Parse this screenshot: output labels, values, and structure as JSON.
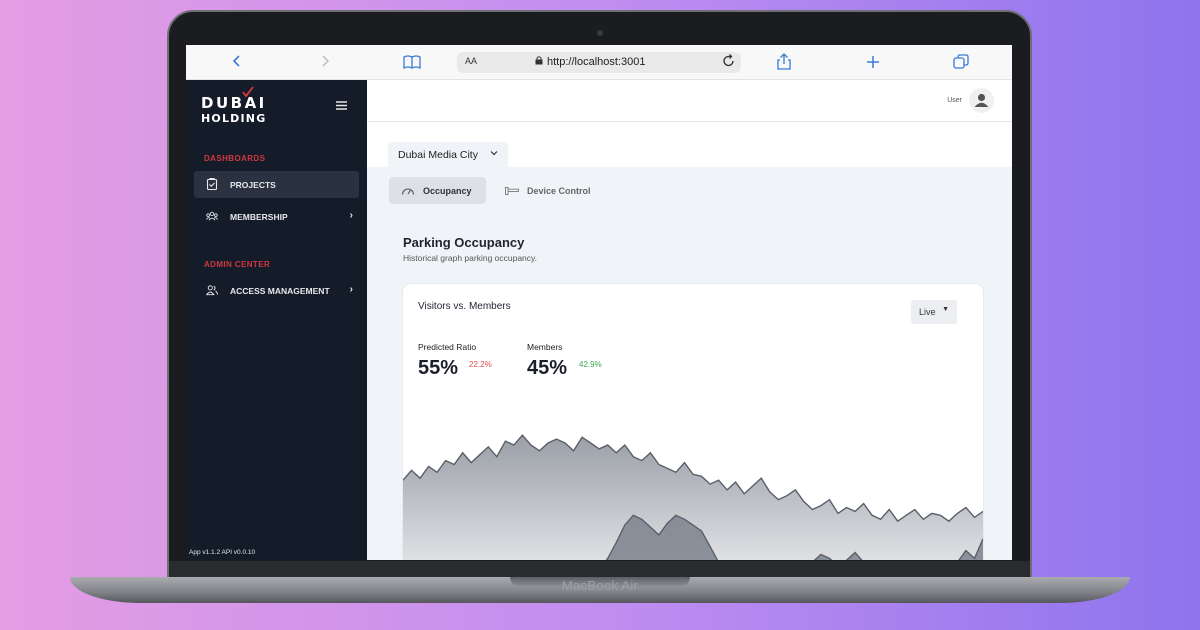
{
  "device": {
    "label": "MacBook Air"
  },
  "browser": {
    "back_icon": "chevron-left-icon",
    "forward_icon": "chevron-right-icon",
    "text_size_label": "AA",
    "url": "http://localhost:3001",
    "icons": [
      "book-icon",
      "lock-icon",
      "reload-icon",
      "share-icon",
      "plus-icon",
      "tabs-icon"
    ]
  },
  "sidebar": {
    "logo_line1": "DUBAI",
    "logo_line2": "HOLDING",
    "sections": [
      {
        "label": "DASHBOARDS",
        "items": [
          {
            "label": "PROJECTS",
            "icon": "clipboard-icon",
            "active": true
          },
          {
            "label": "MEMBERSHIP",
            "icon": "group-icon",
            "has_children": true
          }
        ]
      },
      {
        "label": "ADMIN CENTER",
        "items": [
          {
            "label": "ACCESS MANAGEMENT",
            "icon": "users-icon",
            "has_children": true
          }
        ]
      }
    ],
    "version": "App v1.1.2   API v0.0.10"
  },
  "header": {
    "user_label": "User"
  },
  "location": {
    "selected": "Dubai Media City"
  },
  "tabs": [
    {
      "label": "Occupancy",
      "icon": "gauge-icon",
      "active": true
    },
    {
      "label": "Device Control",
      "icon": "gate-icon",
      "active": false
    }
  ],
  "section": {
    "title": "Parking Occupancy",
    "subtitle": "Historical graph parking occupancy."
  },
  "card": {
    "title": "Visitors vs. Members",
    "range_selected": "Live",
    "stats": [
      {
        "label": "Predicted Ratio",
        "value": "55%",
        "delta": "22.2%",
        "delta_color": "#e04b4b"
      },
      {
        "label": "Members",
        "value": "45%",
        "delta": "42.9%",
        "delta_color": "#3aa853"
      }
    ]
  },
  "colors": {
    "sidebar_bg": "#141b29",
    "accent_red": "#d0383e",
    "content_bg": "#f0f3f7",
    "area_series": "#8c919a"
  },
  "chart_data": {
    "type": "area",
    "ylim": [
      0,
      100
    ],
    "series": [
      {
        "values": [
          48,
          53,
          49,
          55,
          52,
          58,
          56,
          62,
          57,
          61,
          65,
          60,
          68,
          66,
          71,
          66,
          63,
          67,
          69,
          67,
          63,
          70,
          67,
          64,
          66,
          62,
          66,
          60,
          58,
          62,
          56,
          54,
          52,
          57,
          51,
          50,
          46,
          48,
          43,
          47,
          41,
          45,
          49,
          42,
          38,
          40,
          43,
          37,
          33,
          35,
          38,
          31,
          34,
          32,
          36,
          30,
          28,
          33,
          27,
          30,
          33,
          28,
          31,
          30,
          27,
          31,
          34,
          29,
          32
        ]
      },
      {
        "values": [
          0,
          0,
          0,
          0,
          0,
          0,
          0,
          0,
          0,
          0,
          0,
          0,
          0,
          0,
          0,
          0,
          0,
          0,
          0,
          0,
          0,
          0,
          0,
          2,
          8,
          16,
          25,
          30,
          28,
          24,
          20,
          26,
          30,
          28,
          25,
          22,
          14,
          6,
          0,
          0,
          0,
          0,
          0,
          0,
          0,
          0,
          0,
          0,
          6,
          10,
          8,
          4,
          7,
          11,
          6,
          0,
          0,
          0,
          0,
          0,
          0,
          0,
          0,
          0,
          0,
          6,
          12,
          8,
          18
        ]
      }
    ]
  }
}
